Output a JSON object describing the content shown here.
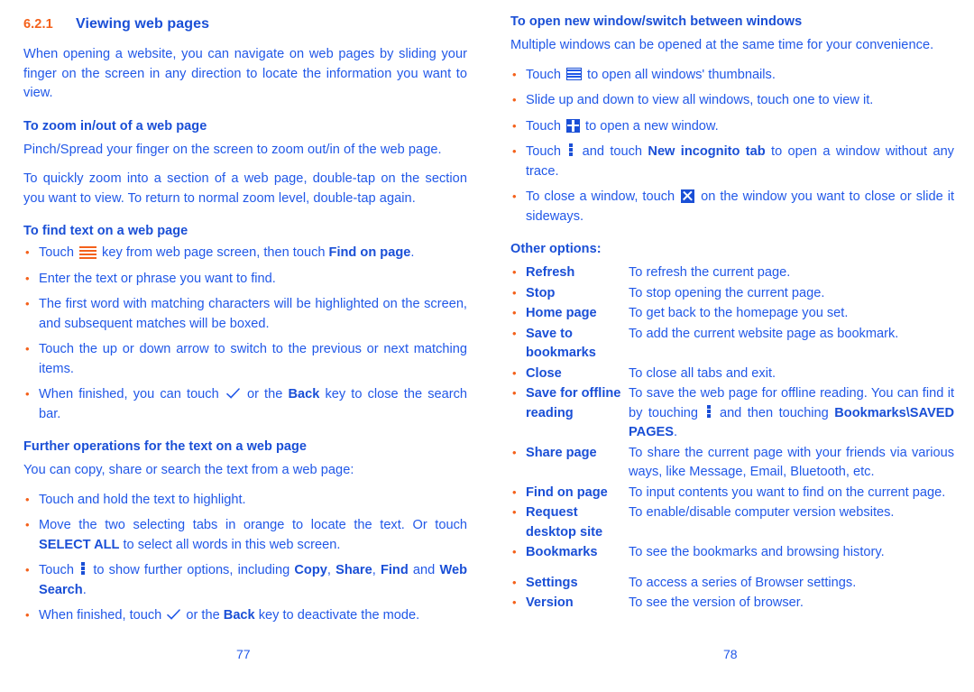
{
  "document": {
    "accent_orange": "#f4611b",
    "accent_blue": "#1a4fd6",
    "body_blue": "#2158e8"
  },
  "left_page": {
    "page_number": "77",
    "section": {
      "number": "6.2.1",
      "title": "Viewing web pages"
    },
    "intro_paragraph": "When opening a website, you can navigate on web pages by sliding your finger on the screen in any direction to locate the information you want to view.",
    "zoom_section": {
      "heading": "To zoom in/out of a web page",
      "paragraph_1": "Pinch/Spread your finger on the screen to zoom out/in of the web page.",
      "paragraph_2": "To quickly zoom into a section of a web page, double-tap on the section you want to view. To return to normal zoom level, double-tap again."
    },
    "find_section": {
      "heading": "To find text on a web page",
      "items": [
        {
          "pre": "Touch ",
          "icon": "menu-key-icon",
          "mid": " key from web page screen, then touch ",
          "bold": "Find on page",
          "post": "."
        },
        {
          "pre": "Enter the text or phrase you want to find."
        },
        {
          "pre": "The first word with matching characters will be highlighted on the screen, and subsequent matches will be boxed."
        },
        {
          "pre": "Touch the up or down arrow to switch to the previous or next matching items."
        },
        {
          "pre": "When finished, you can touch ",
          "icon": "check-icon",
          "mid": " or the ",
          "bold": "Back",
          "post": " key to close the search bar."
        }
      ]
    },
    "further_section": {
      "heading": "Further operations for the text on a web page",
      "lead": "You can copy, share or search the text from a web page:",
      "items": [
        {
          "pre": "Touch and hold the text to highlight."
        },
        {
          "pre": "Move the two selecting tabs in orange to locate the text. Or touch ",
          "bold": "SELECT ALL",
          "post": " to select all words in this web screen."
        },
        {
          "pre": "Touch ",
          "icon": "more-options-icon",
          "mid": " to show further options, including ",
          "bold_list": [
            "Copy",
            "Share",
            "Find",
            "Web Search"
          ],
          "post": "."
        },
        {
          "pre": "When finished, touch ",
          "icon": "check-icon",
          "mid": " or the ",
          "bold": "Back",
          "post": " key to deactivate the mode."
        }
      ],
      "options_inline": {
        "copy": "Copy",
        "share": "Share",
        "find": "Find",
        "and": " and ",
        "web_search": "Web Search"
      }
    }
  },
  "right_page": {
    "page_number": "78",
    "windows_section": {
      "heading": "To open new window/switch between windows",
      "paragraph": "Multiple windows can be opened at the same time for your convenience.",
      "items": [
        {
          "pre": "Touch ",
          "icon": "windows-thumbnails-icon",
          "mid": " to open all windows' thumbnails."
        },
        {
          "pre": "Slide up and down to view all windows, touch one to view it."
        },
        {
          "pre": "Touch ",
          "icon": "new-window-plus-icon",
          "mid": " to open a new window."
        },
        {
          "pre": "Touch ",
          "icon": "more-options-icon",
          "mid": " and touch ",
          "bold": "New incognito tab",
          "post": " to open a window without any trace."
        },
        {
          "pre": "To close a window, touch ",
          "icon": "close-window-icon",
          "mid": " on the window you want to close or slide it sideways."
        }
      ]
    },
    "other_options": {
      "heading": "Other options:",
      "rows": [
        {
          "term": "Refresh",
          "desc": "To refresh the current page."
        },
        {
          "term": "Stop",
          "desc": "To stop opening the current page."
        },
        {
          "term": "Home page",
          "desc": "To get back to the homepage you set."
        },
        {
          "term": "Save to bookmarks",
          "desc": "To add the current website page as bookmark."
        },
        {
          "term": "Close",
          "desc": "To close all tabs and exit."
        },
        {
          "term": "Save for offline reading",
          "desc_pre": "To save the web page for offline reading. You can find it by touching ",
          "icon": "more-options-icon",
          "desc_mid": " and then touching ",
          "desc_bold": "Bookmarks\\SAVED PAGES",
          "desc_post": "."
        },
        {
          "term": "Share page",
          "desc": "To share the current page with your friends via various ways, like Message, Email, Bluetooth, etc."
        },
        {
          "term": "Find on page",
          "desc": "To input contents you want to find on the current page."
        },
        {
          "term": "Request desktop site",
          "desc": "To enable/disable computer version websites."
        },
        {
          "term": "Bookmarks",
          "desc": "To see the bookmarks and browsing history."
        },
        {
          "term": "Settings",
          "desc": "To access a series of Browser settings."
        },
        {
          "term": "Version",
          "desc": "To see the version of browser."
        }
      ]
    }
  }
}
